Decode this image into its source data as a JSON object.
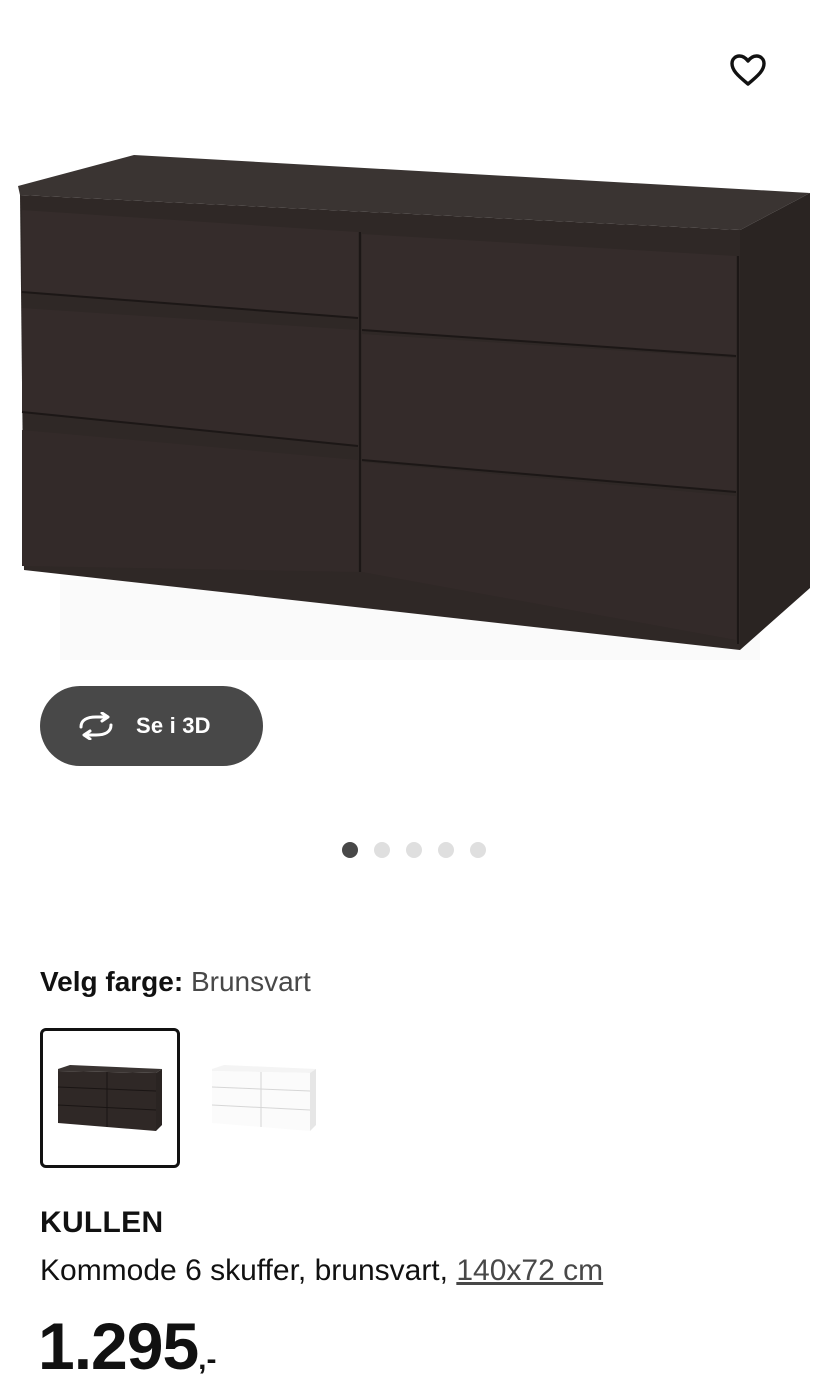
{
  "favorite": {
    "icon": "heart-outline-icon"
  },
  "view3d": {
    "label": "Se i 3D",
    "icon": "rotate-3d-icon"
  },
  "carousel": {
    "total": 5,
    "active_index": 0
  },
  "color_select": {
    "label": "Velg farge:",
    "value": "Brunsvart",
    "options": [
      {
        "name": "Brunsvart",
        "selected": true
      },
      {
        "name": "Hvit",
        "selected": false
      }
    ]
  },
  "product": {
    "name": "KULLEN",
    "description": "Kommode 6 skuffer, brunsvart,",
    "dimensions": "140x72 cm",
    "price_integer": "1.295",
    "price_suffix": ",-"
  },
  "colors": {
    "dark_button": "#484848",
    "dresser_brown": "#2d2624",
    "dot_inactive": "#dfdfdf"
  }
}
